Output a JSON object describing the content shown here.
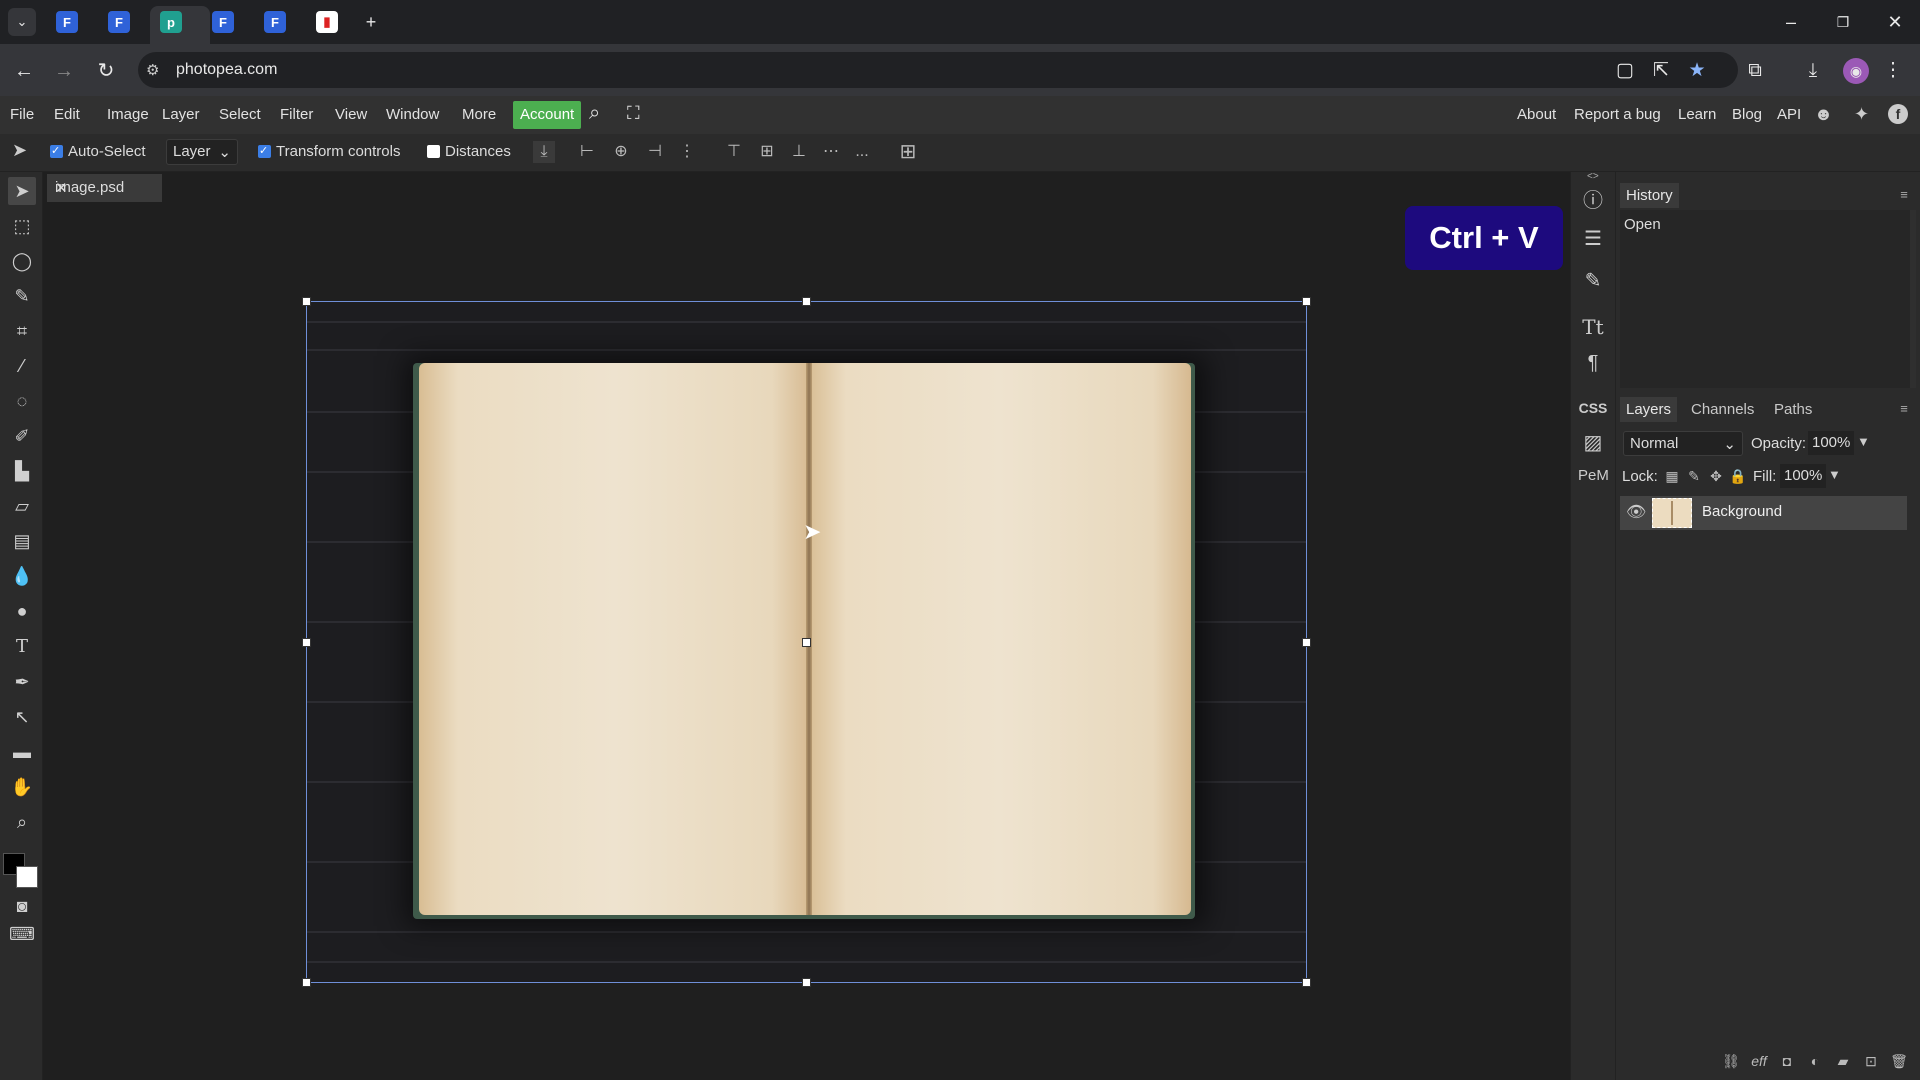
{
  "browser": {
    "url": "photopea.com",
    "new_tab": "+"
  },
  "menu": {
    "items": [
      "File",
      "Edit",
      "Image",
      "Layer",
      "Select",
      "Filter",
      "View",
      "Window",
      "More"
    ],
    "account": "Account",
    "right_links": [
      "About",
      "Report a bug",
      "Learn",
      "Blog",
      "API"
    ]
  },
  "options": {
    "auto_select": "Auto-Select",
    "layer_mode": "Layer",
    "transform_controls": "Transform controls",
    "distances": "Distances",
    "more": "..."
  },
  "document": {
    "tab_name": "image.psd",
    "close": "✕"
  },
  "overlay": {
    "shortcut": "Ctrl + V"
  },
  "sidebar_icons": {
    "css_label": "CSS",
    "pem_label": "PeM"
  },
  "panels": {
    "history_tab": "History",
    "history_items": [
      "Open"
    ],
    "layers_tab": "Layers",
    "channels_tab": "Channels",
    "paths_tab": "Paths",
    "blend_mode": "Normal",
    "opacity_label": "Opacity:",
    "opacity_value": "100%",
    "lock_label": "Lock:",
    "fill_label": "Fill:",
    "fill_value": "100%",
    "layers": [
      {
        "name": "Background",
        "visible": true,
        "selected": true
      }
    ]
  },
  "colors": {
    "accent_account": "#4caf50",
    "badge_bg": "#1d0a7e",
    "checkbox_on": "#3b7ee6"
  }
}
